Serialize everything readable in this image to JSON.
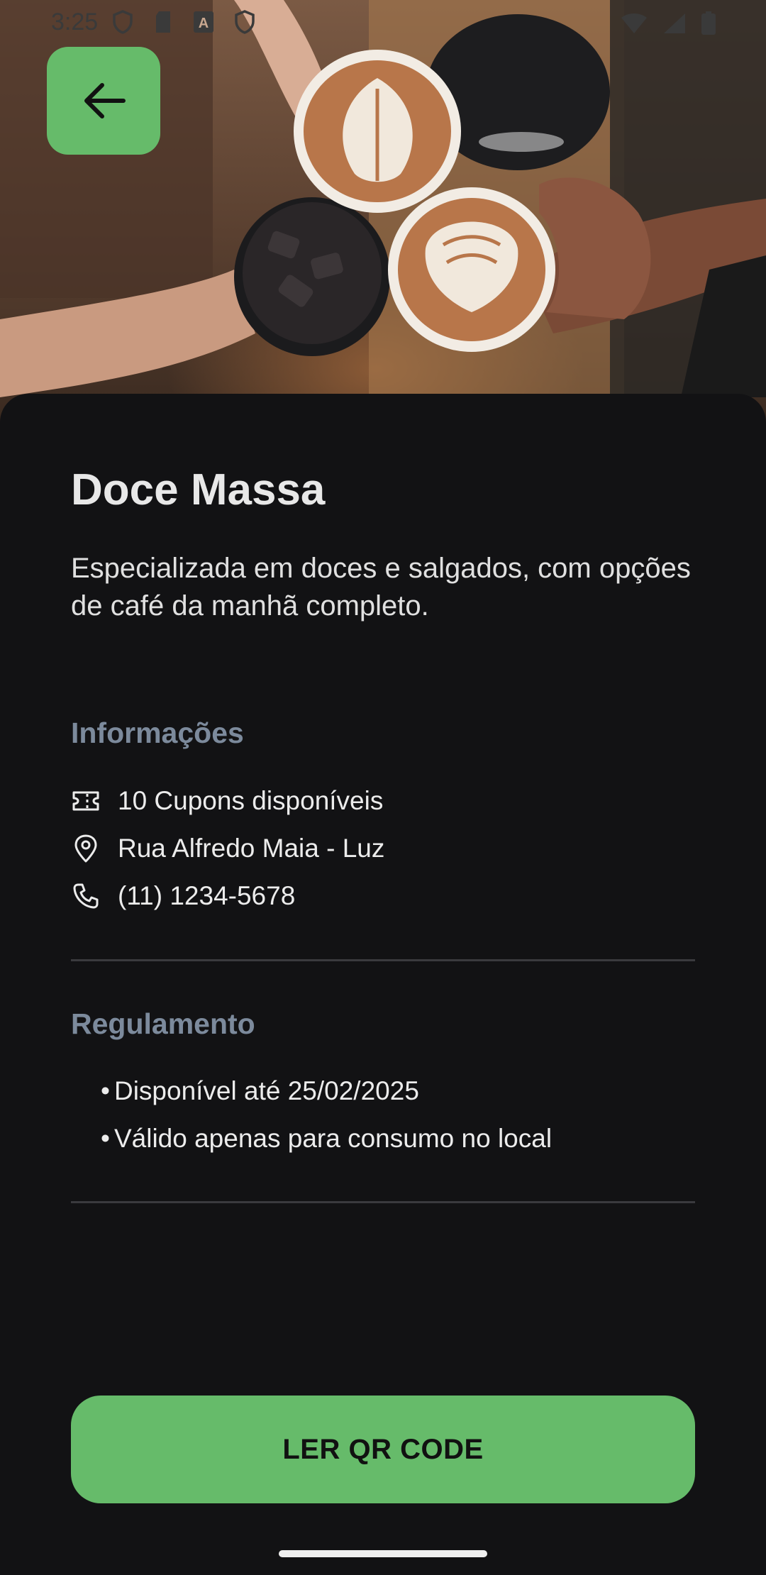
{
  "status_bar": {
    "time": "3:25",
    "left_icons": [
      "shield-icon",
      "sd-card-icon",
      "font-a-icon",
      "shield-icon"
    ],
    "right_icons": [
      "wifi-icon",
      "cell-signal-icon",
      "battery-icon"
    ]
  },
  "hero": {
    "image": "coffee-cups-cheers-photo"
  },
  "store": {
    "name": "Doce Massa",
    "description": "Especializada em doces e salgados, com opções de café da manhã completo."
  },
  "info": {
    "title": "Informações",
    "items": [
      {
        "icon": "ticket-icon",
        "text": "10 Cupons disponíveis"
      },
      {
        "icon": "location-pin-icon",
        "text": "Rua Alfredo Maia - Luz"
      },
      {
        "icon": "phone-icon",
        "text": "(11) 1234-5678"
      }
    ]
  },
  "rules": {
    "title": "Regulamento",
    "bullet": "•",
    "items": [
      "Disponível até 25/02/2025",
      "Válido apenas para consumo no local"
    ]
  },
  "cta": {
    "label": "LER QR CODE"
  },
  "colors": {
    "accent": "#66bb6a",
    "background": "#121214",
    "section_title": "#7c8a9c",
    "text": "#ececec"
  }
}
